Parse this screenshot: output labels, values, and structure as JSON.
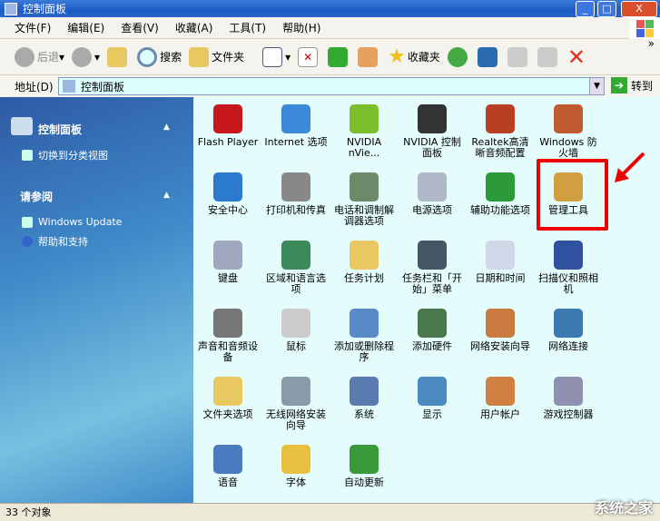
{
  "window": {
    "title": "控制面板",
    "min": "_",
    "max": "□",
    "close": "X"
  },
  "menu": [
    "文件(F)",
    "编辑(E)",
    "查看(V)",
    "收藏(A)",
    "工具(T)",
    "帮助(H)"
  ],
  "toolbar": {
    "back": "后退",
    "search": "搜索",
    "folders": "文件夹",
    "favorites": "收藏夹",
    "more": "»"
  },
  "address": {
    "label": "地址(D)",
    "value": "控制面板",
    "go": "转到"
  },
  "sidebar": {
    "panel_title": "控制面板",
    "switch_view": "切换到分类视图",
    "see_also": "请参阅",
    "links": [
      "Windows Update",
      "帮助和支持"
    ]
  },
  "items": [
    {
      "label": "Flash Player",
      "color": "#c8161d"
    },
    {
      "label": "Internet 选项",
      "color": "#3a8ad8"
    },
    {
      "label": "NVIDIA nVie...",
      "color": "#7bbf2a"
    },
    {
      "label": "NVIDIA 控制面板",
      "color": "#333333"
    },
    {
      "label": "Realtek高清晰音频配置",
      "color": "#b84020"
    },
    {
      "label": "Windows 防火墙",
      "color": "#c05a30"
    },
    {
      "label": "安全中心",
      "color": "#2a7ad0"
    },
    {
      "label": "打印机和传真",
      "color": "#888888"
    },
    {
      "label": "电话和调制解调器选项",
      "color": "#6a8a6a"
    },
    {
      "label": "电源选项",
      "color": "#b0b8c8"
    },
    {
      "label": "辅助功能选项",
      "color": "#2a9a3a"
    },
    {
      "label": "管理工具",
      "color": "#d0a040"
    },
    {
      "label": "键盘",
      "color": "#a0a8c0"
    },
    {
      "label": "区域和语言选项",
      "color": "#3a8a5a"
    },
    {
      "label": "任务计划",
      "color": "#e8c860"
    },
    {
      "label": "任务栏和「开始」菜单",
      "color": "#445566"
    },
    {
      "label": "日期和时间",
      "color": "#d0d8e8"
    },
    {
      "label": "扫描仪和照相机",
      "color": "#3050a0"
    },
    {
      "label": "声音和音频设备",
      "color": "#777777"
    },
    {
      "label": "鼠标",
      "color": "#cccccc"
    },
    {
      "label": "添加或删除程序",
      "color": "#5a8ac8"
    },
    {
      "label": "添加硬件",
      "color": "#4a7a4a"
    },
    {
      "label": "网络安装向导",
      "color": "#c87a40"
    },
    {
      "label": "网络连接",
      "color": "#3a7ab0"
    },
    {
      "label": "文件夹选项",
      "color": "#e8c860"
    },
    {
      "label": "无线网络安装向导",
      "color": "#8a9aa8"
    },
    {
      "label": "系统",
      "color": "#5a7ab0"
    },
    {
      "label": "显示",
      "color": "#4a8ac0"
    },
    {
      "label": "用户帐户",
      "color": "#d08040"
    },
    {
      "label": "游戏控制器",
      "color": "#9090b0"
    },
    {
      "label": "语音",
      "color": "#4a7ac0"
    },
    {
      "label": "字体",
      "color": "#e8c040"
    },
    {
      "label": "自动更新",
      "color": "#3a9a3a"
    }
  ],
  "status": "33 个对象",
  "watermark": "系统之家"
}
